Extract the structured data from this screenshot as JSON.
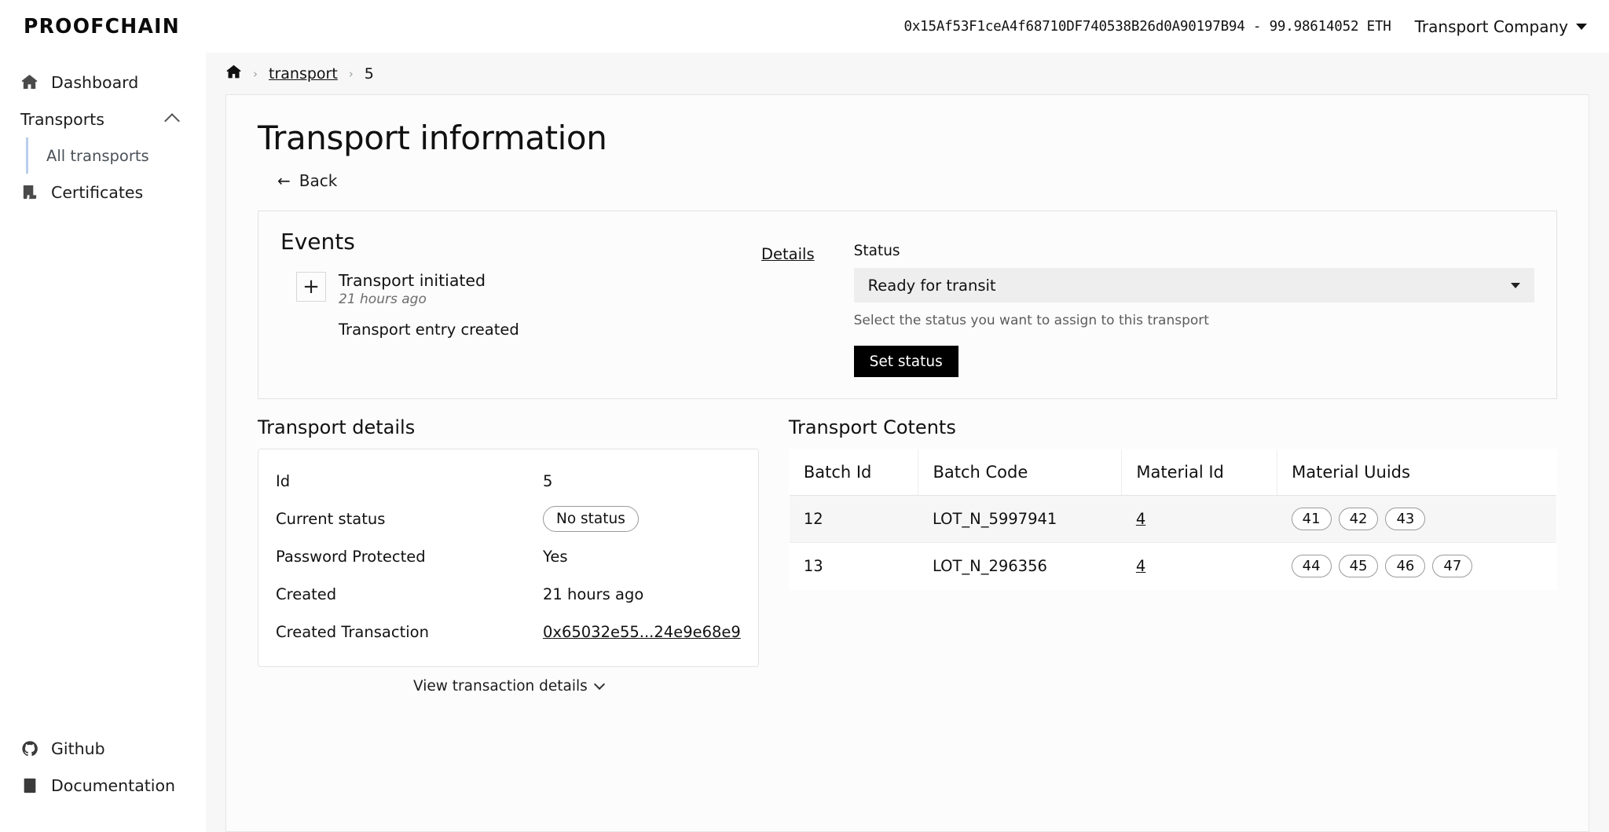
{
  "header": {
    "logo": "PROOFCHAIN",
    "wallet": "0x15Af53F1ceA4f68710DF740538B26d0A90197B94 - 99.98614052 ETH",
    "account": "Transport Company"
  },
  "sidebar": {
    "dashboard": "Dashboard",
    "transports_group": "Transports",
    "all_transports": "All transports",
    "certificates": "Certificates",
    "github": "Github",
    "documentation": "Documentation"
  },
  "breadcrumb": {
    "home_icon": "home-icon",
    "sep": "›",
    "link": "transport",
    "current": "5"
  },
  "page": {
    "title": "Transport information",
    "back": "Back",
    "back_arrow": "←"
  },
  "events": {
    "title": "Events",
    "expand_label": "+",
    "event_name": "Transport initiated",
    "event_time": "21 hours ago",
    "event_desc": "Transport entry created",
    "details_link": "Details"
  },
  "status_form": {
    "label": "Status",
    "selected": "Ready for transit",
    "hint": "Select the status you want to assign to this transport",
    "submit": "Set status"
  },
  "transport_details": {
    "title": "Transport details",
    "rows": [
      {
        "key": "Id",
        "value": "5",
        "type": "text"
      },
      {
        "key": "Current status",
        "value": "No status",
        "type": "pill"
      },
      {
        "key": "Password Protected",
        "value": "Yes",
        "type": "text"
      },
      {
        "key": "Created",
        "value": "21 hours ago",
        "type": "text"
      },
      {
        "key": "Created Transaction",
        "value": "0x65032e55...24e9e68e9",
        "type": "link"
      }
    ],
    "view_tx": "View transaction details"
  },
  "transport_contents": {
    "title": "Transport Cotents",
    "columns": [
      "Batch Id",
      "Batch Code",
      "Material Id",
      "Material Uuids"
    ],
    "rows": [
      {
        "batch_id": "12",
        "batch_code": "LOT_N_5997941",
        "material_id": "4",
        "material_uuids": [
          "41",
          "42",
          "43"
        ]
      },
      {
        "batch_id": "13",
        "batch_code": "LOT_N_296356",
        "material_id": "4",
        "material_uuids": [
          "44",
          "45",
          "46",
          "47"
        ]
      }
    ]
  },
  "colors": {
    "accent_nav": "#b9cdec",
    "button_dark": "#000000",
    "select_bg": "#eeeeee",
    "content_bg": "#f7f7f7"
  }
}
